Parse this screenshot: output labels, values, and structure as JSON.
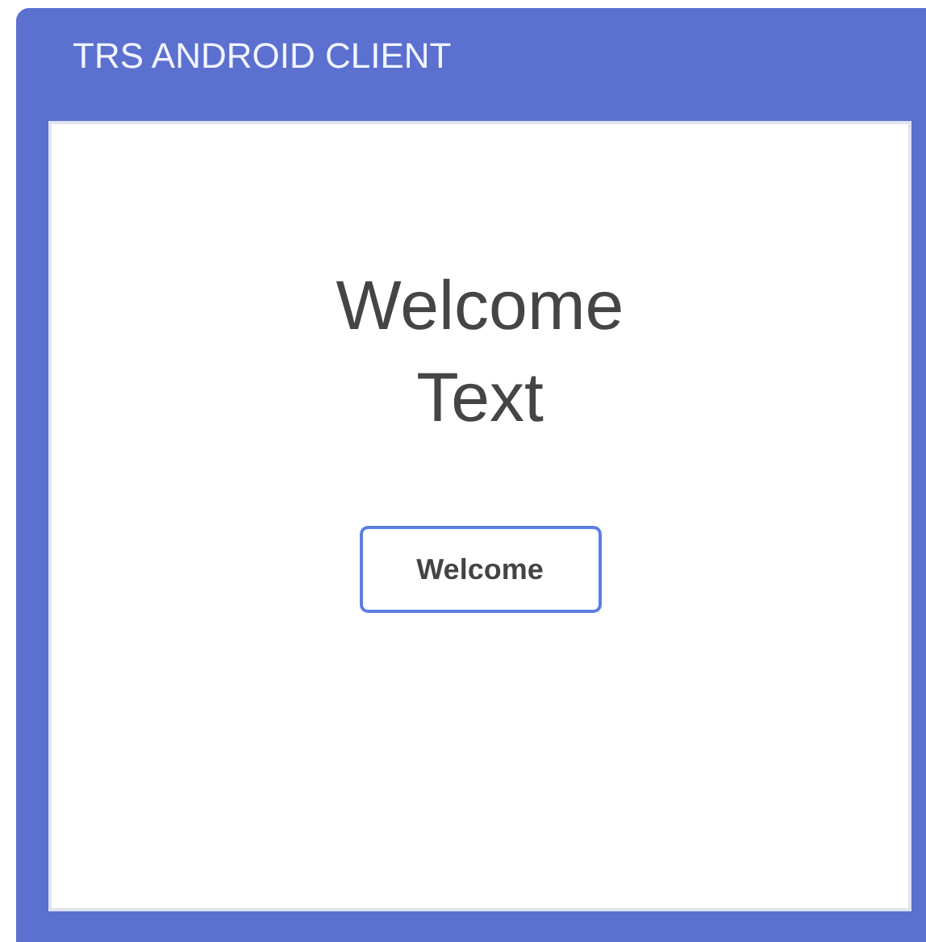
{
  "window": {
    "title": "TRS ANDROID CLIENT"
  },
  "content": {
    "heading": "Welcome Text",
    "button": "Welcome"
  }
}
